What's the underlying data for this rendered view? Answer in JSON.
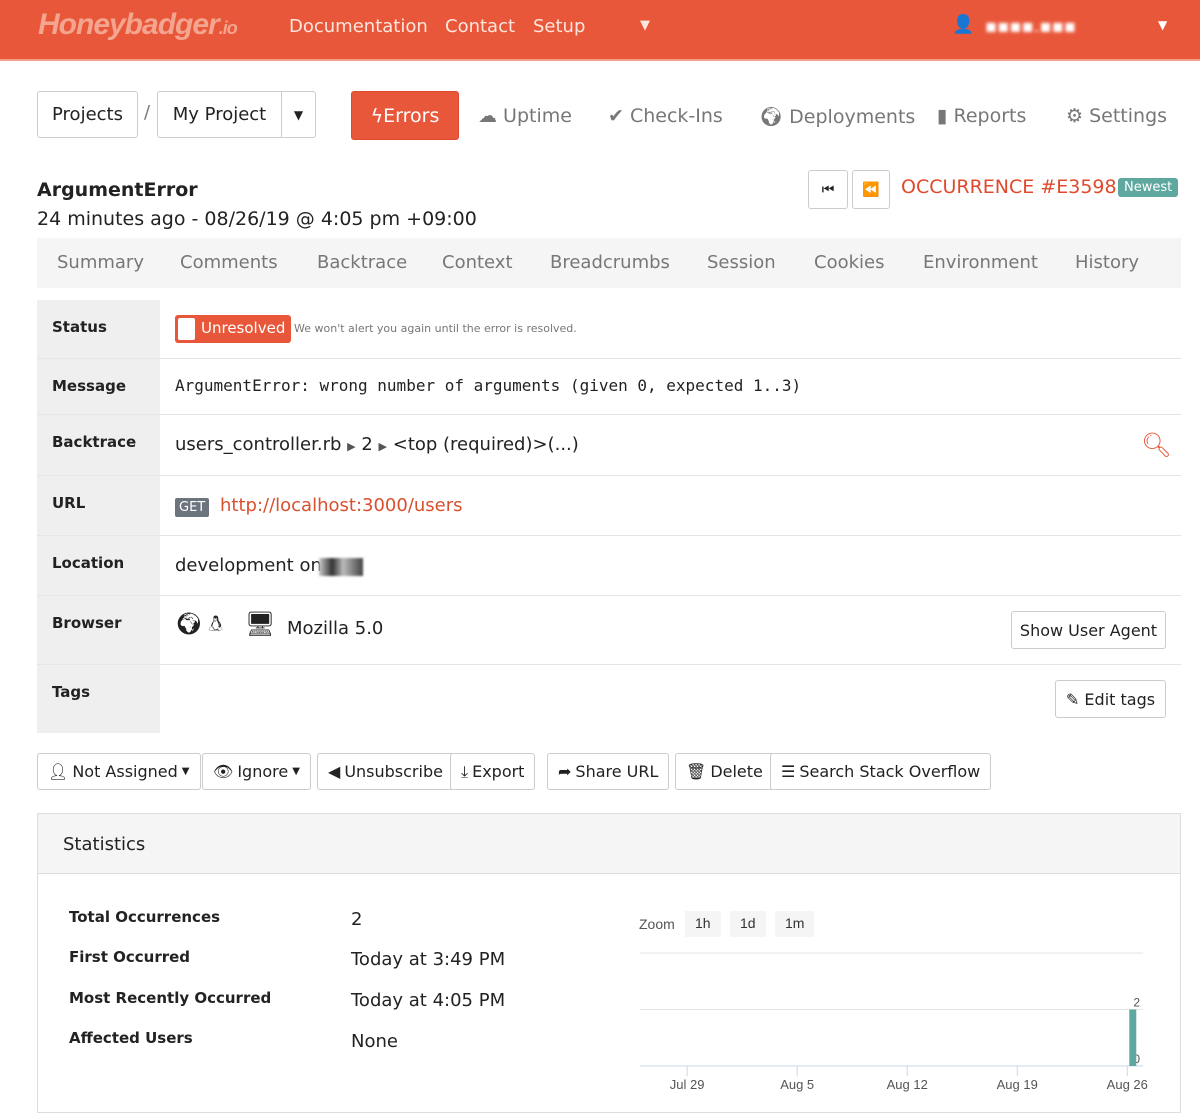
{
  "header": {
    "logo": "Honeybadger",
    "logo_suffix": ".io",
    "nav": [
      "Documentation",
      "Contact",
      "Setup"
    ],
    "user": "▪▪▪▪.▪▪▪"
  },
  "project_nav": {
    "projects": "Projects",
    "separator": "/",
    "project": "My Project",
    "tabs": [
      {
        "label": "Errors",
        "icon": "bolt-icon"
      },
      {
        "label": "Uptime",
        "icon": "cloud-upload-icon"
      },
      {
        "label": "Check-Ins",
        "icon": "check-icon"
      },
      {
        "label": "Deployments",
        "icon": "globe-icon"
      },
      {
        "label": "Reports",
        "icon": "file-icon"
      },
      {
        "label": "Settings",
        "icon": "gear-icon"
      }
    ]
  },
  "error": {
    "title": "ArgumentError",
    "time": "24 minutes ago - 08/26/19 @ 4:05 pm +09:00",
    "occurrence": "OCCURRENCE #E3598",
    "badge": "Newest"
  },
  "tabs": [
    "Summary",
    "Comments",
    "Backtrace",
    "Context",
    "Breadcrumbs",
    "Session",
    "Cookies",
    "Environment",
    "History"
  ],
  "details": {
    "status": {
      "label": "Status",
      "value": "Unresolved",
      "note": "We won't alert you again until the error is resolved."
    },
    "message": {
      "label": "Message",
      "value": "ArgumentError: wrong number of arguments (given 0, expected 1..3)"
    },
    "backtrace": {
      "label": "Backtrace",
      "file": "users_controller.rb",
      "line": "2",
      "method": "<top (required)>(...)"
    },
    "url": {
      "label": "URL",
      "method": "GET",
      "value": "http://localhost:3000/users"
    },
    "location": {
      "label": "Location",
      "value": "development on"
    },
    "browser": {
      "label": "Browser",
      "value": "Mozilla 5.0",
      "button": "Show User Agent"
    },
    "tags": {
      "label": "Tags",
      "button": "Edit tags"
    }
  },
  "actions": [
    "Not Assigned",
    "Ignore",
    "Unsubscribe",
    "Export",
    "Share URL",
    "Delete",
    "Search Stack Overflow"
  ],
  "statistics": {
    "title": "Statistics",
    "items": [
      {
        "label": "Total Occurrences",
        "value": "2"
      },
      {
        "label": "First Occurred",
        "value": "Today at 3:49 PM"
      },
      {
        "label": "Most Recently Occurred",
        "value": "Today at 4:05 PM"
      },
      {
        "label": "Affected Users",
        "value": "None"
      }
    ],
    "zoom_label": "Zoom",
    "zoom": [
      "1h",
      "1d",
      "1m"
    ]
  },
  "colors": {
    "brand": "#e9573a",
    "bar": "#5fa8a0",
    "badge": "#5fa8a0"
  },
  "chart_data": {
    "type": "bar",
    "x_ticks": [
      "Jul 29",
      "Aug 5",
      "Aug 12",
      "Aug 19",
      "Aug 26"
    ],
    "y_ticks": [
      "0",
      "2"
    ],
    "points": [
      {
        "date": "2019-08-26",
        "value": 2
      }
    ],
    "xlim": [
      "2019-07-26",
      "2019-08-27"
    ],
    "ylim": [
      0,
      4
    ],
    "grid": true
  }
}
